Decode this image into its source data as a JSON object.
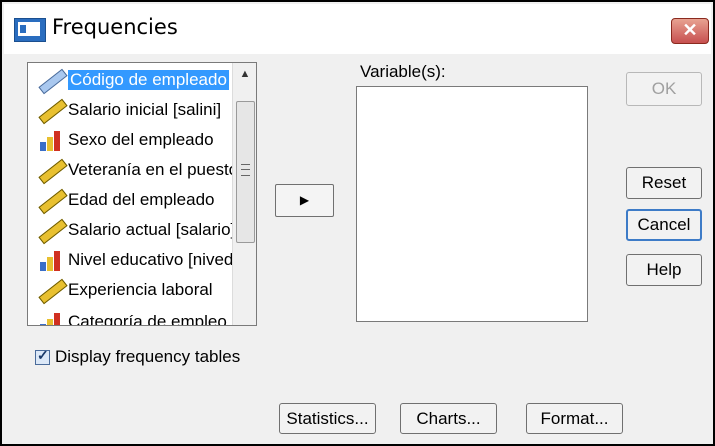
{
  "window": {
    "title": "Frequencies",
    "close_label": "✕"
  },
  "source_list": {
    "items": [
      {
        "label": "Código de empleado",
        "icon": "ruler-icon",
        "selected": true
      },
      {
        "label": "Salario inicial [salini]",
        "icon": "ruler-icon",
        "selected": false
      },
      {
        "label": "Sexo del empleado",
        "icon": "bar-chart-icon",
        "selected": false
      },
      {
        "label": "Veteranía en el puesto",
        "icon": "ruler-icon",
        "selected": false
      },
      {
        "label": "Edad del empleado",
        "icon": "ruler-icon",
        "selected": false
      },
      {
        "label": "Salario actual [salario]",
        "icon": "ruler-icon",
        "selected": false
      },
      {
        "label": "Nivel educativo [niveduc]",
        "icon": "bar-chart-icon",
        "selected": false
      },
      {
        "label": "Experiencia laboral",
        "icon": "ruler-icon",
        "selected": false
      },
      {
        "label": "Categoría de empleo",
        "icon": "bar-chart-icon",
        "selected": false
      }
    ]
  },
  "move_button": {
    "glyph": "▶"
  },
  "target": {
    "label": "Variable(s):"
  },
  "buttons": {
    "ok": "OK",
    "reset": "Reset",
    "cancel": "Cancel",
    "help": "Help",
    "statistics": "Statistics...",
    "charts": "Charts...",
    "format": "Format..."
  },
  "display_frequency_tables": {
    "label": "Display frequency tables",
    "checked": true,
    "mark": "✓"
  },
  "colors": {
    "selection": "#3399ff",
    "close_button": "#c75050",
    "default_border": "#3d7bc7"
  }
}
